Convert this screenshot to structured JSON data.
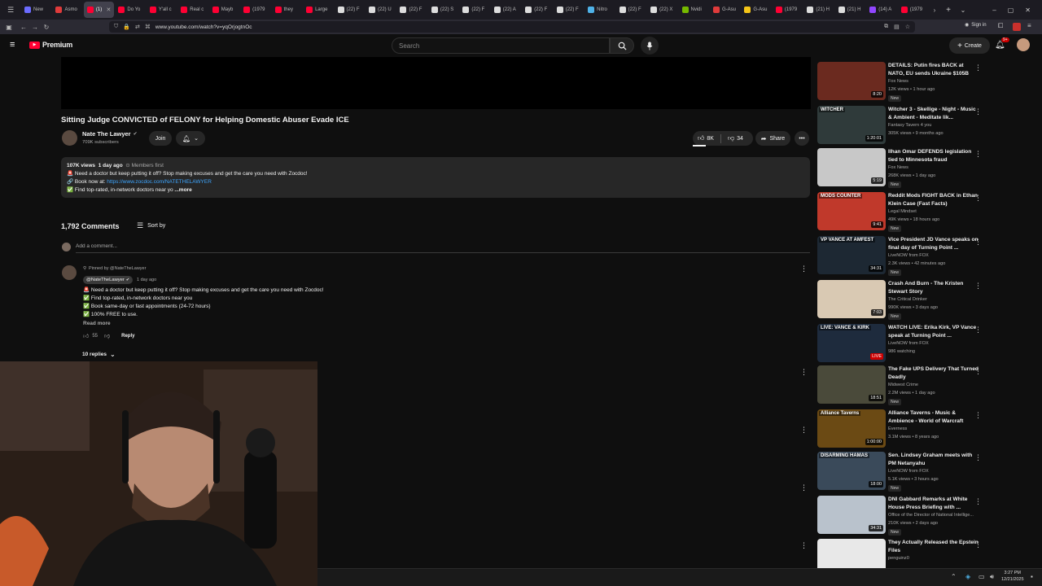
{
  "browser": {
    "tabs": [
      {
        "label": "New",
        "color": "#6c6cff"
      },
      {
        "label": "Asmo",
        "color": "#e03b3b"
      },
      {
        "label": "(1)",
        "color": "#ff0033",
        "active": true
      },
      {
        "label": "Do Yo",
        "color": "#ff0033"
      },
      {
        "label": "Y'all c",
        "color": "#ff0033"
      },
      {
        "label": "Real c",
        "color": "#ff0033"
      },
      {
        "label": "Mayb",
        "color": "#ff0033"
      },
      {
        "label": "(1979",
        "color": "#ff0033"
      },
      {
        "label": "they",
        "color": "#ff0033"
      },
      {
        "label": "Large",
        "color": "#ff0033"
      },
      {
        "label": "(22) F",
        "color": "#dddddd"
      },
      {
        "label": "(22) U",
        "color": "#dddddd"
      },
      {
        "label": "(22) F",
        "color": "#dddddd"
      },
      {
        "label": "(22) S",
        "color": "#dddddd"
      },
      {
        "label": "(22) F",
        "color": "#dddddd"
      },
      {
        "label": "(22) A",
        "color": "#dddddd"
      },
      {
        "label": "(22) F",
        "color": "#dddddd"
      },
      {
        "label": "(22) F",
        "color": "#dddddd"
      },
      {
        "label": "Nitro",
        "color": "#4fb2e8"
      },
      {
        "label": "(22) F",
        "color": "#dddddd"
      },
      {
        "label": "(22) X",
        "color": "#dddddd"
      },
      {
        "label": "Nvidi",
        "color": "#76b900"
      },
      {
        "label": "G-Asu",
        "color": "#e03b3b"
      },
      {
        "label": "G-Asu",
        "color": "#f5c518"
      },
      {
        "label": "(1979",
        "color": "#ff0033"
      },
      {
        "label": "(21) H",
        "color": "#dddddd"
      },
      {
        "label": "(21) H",
        "color": "#dddddd"
      },
      {
        "label": "(14) A",
        "color": "#9146ff"
      },
      {
        "label": "(1979",
        "color": "#ff0033"
      }
    ],
    "url": "www.youtube.com/watch?v=yqOrjogtnOc",
    "sign_in": "Sign in"
  },
  "header": {
    "logo_text": "Premium",
    "search_placeholder": "Search",
    "create_label": "Create",
    "notif_count": "9+"
  },
  "video": {
    "title": "Sitting Judge CONVICTED of FELONY for Helping Domestic Abuser Evade ICE",
    "channel": "Nate The Lawyer",
    "subscribers": "709K subscribers",
    "join_label": "Join",
    "likes": "8K",
    "dislikes": "34",
    "share_label": "Share"
  },
  "description": {
    "views": "107K views",
    "age": "1 day ago",
    "members": "Members first",
    "line1": "🚨 Need a doctor but keep putting it off? Stop making excuses and get the care you need with Zocdoc!",
    "line2_prefix": "🔗 Book now at: ",
    "line2_link": "https://www.zocdoc.com/NATETHELAWYER",
    "line3": "✅ Find top-rated, in-network doctors near yo",
    "more": "...more"
  },
  "comments": {
    "count_label": "1,792 Comments",
    "sort_label": "Sort by",
    "add_placeholder": "Add a comment...",
    "pinned": {
      "pinned_label": "Pinned by @NateTheLawyer",
      "author": "@NateTheLawyer",
      "age": "1 day ago",
      "lines": [
        "🚨 Need a doctor but keep putting it off? Stop making excuses and get the care you need with Zocdoc!",
        "✅ Find top-rated, in-network doctors near you",
        "✅ Book same-day or fast appointments (24-72 hours)",
        "✅ 100% FREE to use."
      ],
      "read_more": "Read more",
      "likes": "55",
      "reply_label": "Reply",
      "replies_label": "10 replies"
    }
  },
  "sidebar": {
    "items": [
      {
        "title": "DETAILS: Putin fires BACK at NATO, EU sends Ukraine $105B",
        "channel": "Fox News",
        "meta": "12K views • 1 hour ago",
        "badge": "New",
        "duration": "8:20",
        "thumb": "#6b2a1f",
        "overlay": ""
      },
      {
        "title": "Witcher 3 - Skellige - Night - Music & Ambient - Meditate lik...",
        "channel": "Fantasy Tavern 4 you",
        "meta": "305K views • 9 months ago",
        "badge": "",
        "duration": "1:20:01",
        "thumb": "#2f3a3a",
        "overlay": "WITCHER"
      },
      {
        "title": "Ilhan Omar DEFENDS legislation tied to Minnesota fraud",
        "channel": "Fox News",
        "meta": "268K views • 1 day ago",
        "badge": "New",
        "duration": "5:19",
        "thumb": "#c8c8c8",
        "overlay": ""
      },
      {
        "title": "Reddit Mods FIGHT BACK in Ethan Klein Case (Fast Facts)",
        "channel": "Legal Mindset",
        "meta": "49K views • 18 hours ago",
        "badge": "New",
        "duration": "9:41",
        "thumb": "#c0392b",
        "overlay": "MODS COUNTER"
      },
      {
        "title": "Vice President JD Vance speaks on final day of Turning Point ...",
        "channel": "LiveNOW from FOX",
        "meta": "2.3K views • 42 minutes ago",
        "badge": "New",
        "duration": "34:31",
        "thumb": "#1d2833",
        "overlay": "VP VANCE AT AMFEST"
      },
      {
        "title": "Crash And Burn - The Kristen Stewart Story",
        "channel": "The Critical Drinker",
        "meta": "990K views • 3 days ago",
        "badge": "New",
        "duration": "7:03",
        "thumb": "#d9c9b3",
        "overlay": ""
      },
      {
        "title": "WATCH LIVE: Erika Kirk, VP Vance speak at Turning Point ...",
        "channel": "LiveNOW from FOX",
        "meta": "986 watching",
        "badge": "",
        "duration": "LIVE",
        "thumb": "#1e2b3d",
        "overlay": "LIVE: VANCE & KIRK"
      },
      {
        "title": "The Fake UPS Delivery That Turned Deadly",
        "channel": "Midwest Crime",
        "meta": "2.2M views • 1 day ago",
        "badge": "New",
        "duration": "18:51",
        "thumb": "#4a4a3a",
        "overlay": ""
      },
      {
        "title": "Alliance Taverns - Music & Ambience - World of Warcraft",
        "channel": "Everness",
        "meta": "3.1M views • 8 years ago",
        "badge": "",
        "duration": "1:00:00",
        "thumb": "#6b4a14",
        "overlay": "Alliance Taverns"
      },
      {
        "title": "Sen. Lindsey Graham meets with PM Netanyahu",
        "channel": "LiveNOW from FOX",
        "meta": "5.1K views • 3 hours ago",
        "badge": "New",
        "duration": "18:00",
        "thumb": "#3a4a5a",
        "overlay": "DISARMING HAMAS"
      },
      {
        "title": "DNI Gabbard Remarks at White House Press Briefing with ...",
        "channel": "Office of the Director of National Intellige...",
        "meta": "210K views • 2 days ago",
        "badge": "New",
        "duration": "34:31",
        "thumb": "#b9c2cc",
        "overlay": ""
      },
      {
        "title": "They Actually Released the Epstein Files",
        "channel": "penguinz0",
        "meta": "",
        "badge": "",
        "duration": "",
        "thumb": "#e8e8e8",
        "overlay": ""
      }
    ]
  },
  "taskbar": {
    "time": "3:27 PM",
    "date": "12/21/2025"
  },
  "colors": {
    "bg": "#0f0f0f",
    "accent_red": "#ff0033",
    "link_blue": "#3ea6ff"
  }
}
